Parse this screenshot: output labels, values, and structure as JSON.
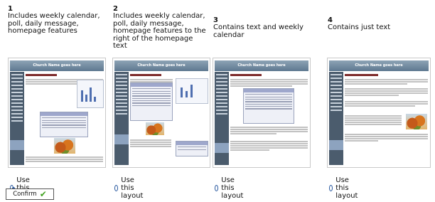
{
  "layouts": [
    {
      "number": "1",
      "description": "Includes weekly calendar, poll, daily message, homepage features",
      "site_title": "Church Name goes here",
      "option_label": "Use this layout",
      "selected": true
    },
    {
      "number": "2",
      "description": "Includes weekly calendar, poll, daily message, homepage features to the right of the homepage text",
      "site_title": "Church Name goes here",
      "option_label": "Use this layout",
      "selected": false
    },
    {
      "number": "3",
      "description": "Contains text and weekly calendar",
      "site_title": "Church Name goes here",
      "option_label": "Use this layout",
      "selected": false
    },
    {
      "number": "4",
      "description": "Contains just text",
      "site_title": "Church Name goes here",
      "option_label": "Use this layout",
      "selected": false
    }
  ],
  "confirm": {
    "label": "Confirm",
    "icon": "checkmark-icon"
  }
}
